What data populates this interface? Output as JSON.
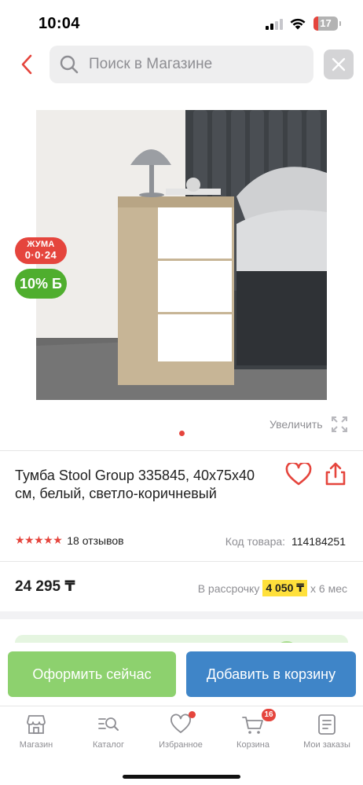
{
  "status_bar": {
    "time": "10:04",
    "battery_level": "17",
    "icons": [
      "signal-icon",
      "wifi-icon",
      "battery-icon"
    ]
  },
  "header": {
    "back_icon": "chevron-left-icon",
    "search_placeholder": "Поиск в Магазине",
    "search_icon": "search-icon",
    "clear_icon": "close-icon"
  },
  "product": {
    "promo_badge": {
      "line1": "ЖУМА",
      "line2": "0·0·24"
    },
    "bonus_badge": "10% Б",
    "zoom_label": "Увеличить",
    "title": "Тумба Stool Group 335845, 40х75х40 см, белый, светло-коричневый",
    "rating_stars": 5,
    "reviews": "18 отзывов",
    "code_label": "Код товара:",
    "code_value": "114184251",
    "price": "24 295 ₸",
    "installment_prefix": "В рассрочку",
    "installment_amount": "4 050 ₸",
    "installment_suffix": "х 6 мес"
  },
  "actions": {
    "buy_now": "Оформить сейчас",
    "add_to_cart": "Добавить в корзину"
  },
  "tabs": [
    {
      "label": "Магазин",
      "icon": "store-icon"
    },
    {
      "label": "Каталог",
      "icon": "catalog-search-icon"
    },
    {
      "label": "Избранное",
      "icon": "heart-icon",
      "has_dot": true
    },
    {
      "label": "Корзина",
      "icon": "cart-icon",
      "badge": "16"
    },
    {
      "label": "Мои заказы",
      "icon": "orders-icon"
    }
  ],
  "colors": {
    "accent_red": "#e5453d",
    "buy_green": "#8dd16e",
    "cart_blue": "#3f85c8",
    "installment_yellow": "#ffe03b",
    "bonus_green": "#4fae2e"
  }
}
